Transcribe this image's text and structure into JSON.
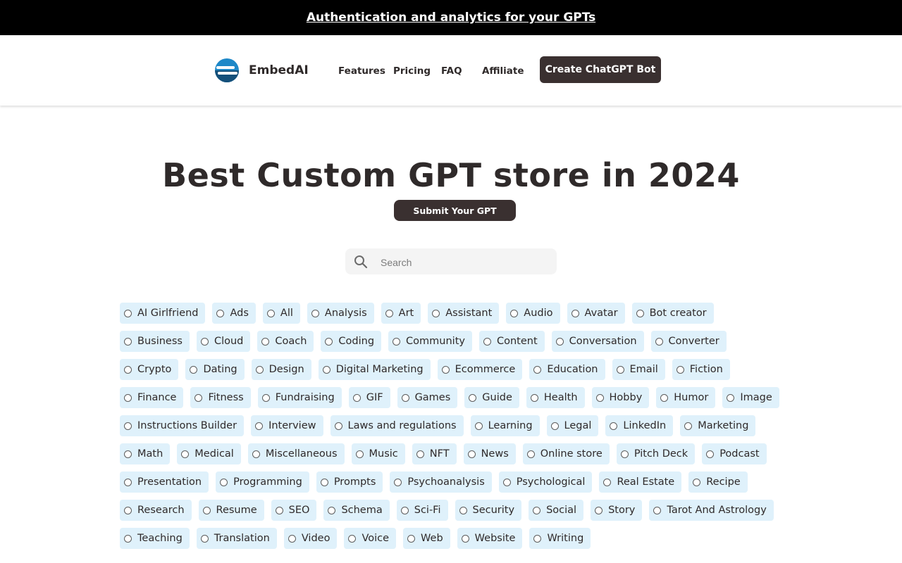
{
  "banner": {
    "text": "Authentication and analytics for your GPTs"
  },
  "header": {
    "brand": "EmbedAI",
    "nav": [
      "Features",
      "Pricing",
      "FAQ",
      "Affiliate"
    ],
    "cta_label": "Create ChatGPT Bot"
  },
  "hero": {
    "title": "Best Custom GPT store in 2024",
    "submit_label": "Submit Your GPT"
  },
  "search": {
    "placeholder": "Search",
    "value": ""
  },
  "categories": [
    "AI Girlfriend",
    "Ads",
    "All",
    "Analysis",
    "Art",
    "Assistant",
    "Audio",
    "Avatar",
    "Bot creator",
    "Business",
    "Cloud",
    "Coach",
    "Coding",
    "Community",
    "Content",
    "Conversation",
    "Converter",
    "Crypto",
    "Dating",
    "Design",
    "Digital Marketing",
    "Ecommerce",
    "Education",
    "Email",
    "Fiction",
    "Finance",
    "Fitness",
    "Fundraising",
    "GIF",
    "Games",
    "Guide",
    "Health",
    "Hobby",
    "Humor",
    "Image",
    "Instructions Builder",
    "Interview",
    "Laws and regulations",
    "Learning",
    "Legal",
    "LinkedIn",
    "Marketing",
    "Math",
    "Medical",
    "Miscellaneous",
    "Music",
    "NFT",
    "News",
    "Online store",
    "Pitch Deck",
    "Podcast",
    "Presentation",
    "Programming",
    "Prompts",
    "Psychoanalysis",
    "Psychological",
    "Real Estate",
    "Recipe",
    "Research",
    "Resume",
    "SEO",
    "Schema",
    "Sci-Fi",
    "Security",
    "Social",
    "Story",
    "Tarot And Astrology",
    "Teaching",
    "Translation",
    "Video",
    "Voice",
    "Web",
    "Website",
    "Writing"
  ],
  "colors": {
    "banner_bg": "#000000",
    "button_bg": "#3a3030",
    "chip_bg": "#dff1fb",
    "logo_blue": "#1e88c8"
  },
  "icons": {
    "logo": "embedai-logo-icon",
    "search": "search-icon",
    "radio": "radio-icon"
  }
}
